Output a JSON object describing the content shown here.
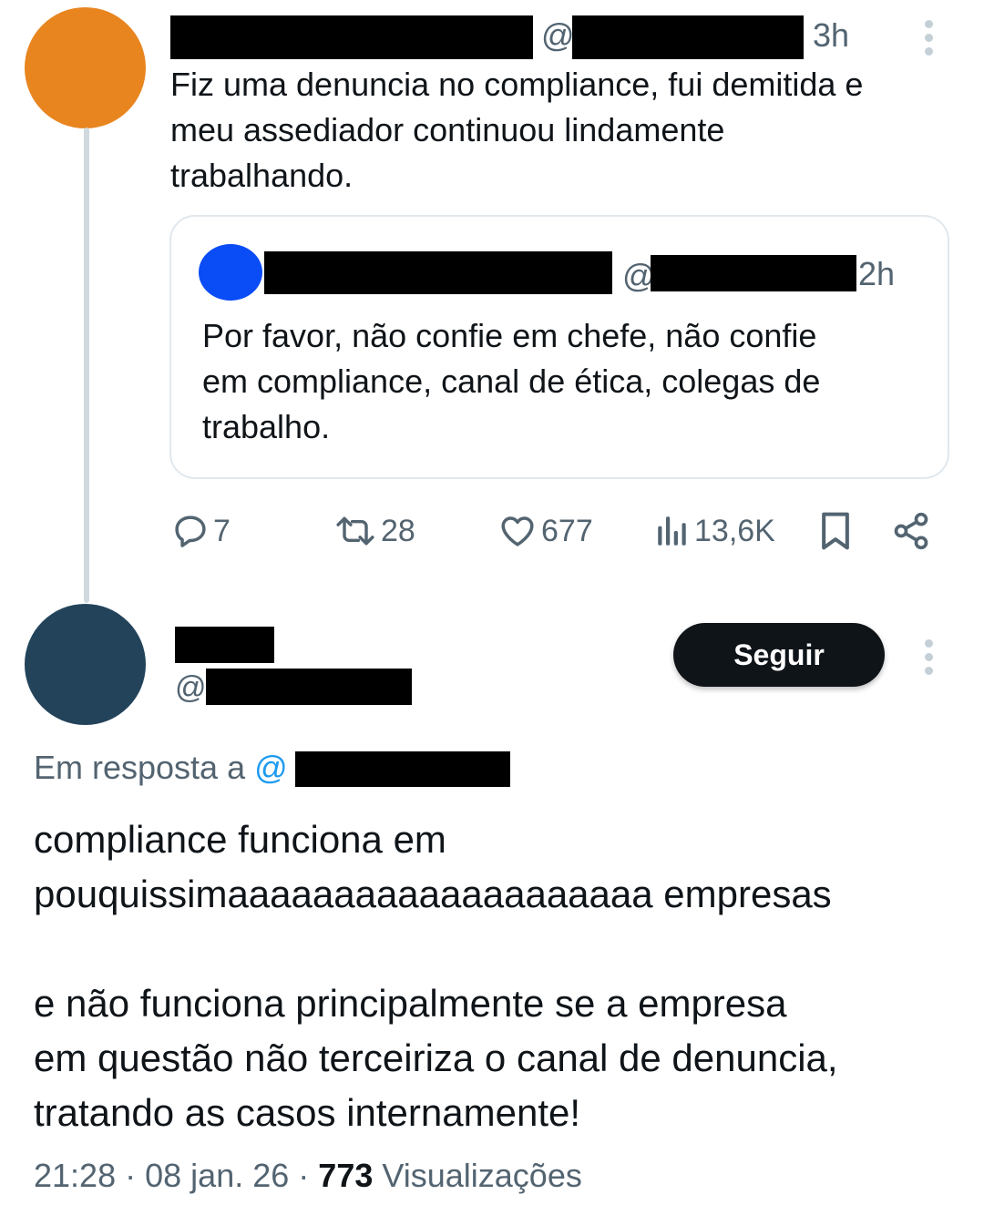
{
  "colors": {
    "avatar_author": "#e8851f",
    "avatar_quoted": "#0a4cf5",
    "avatar_replier": "#23435a",
    "text_primary": "#0f1419",
    "text_muted": "#536471",
    "link_blue": "#1d9bf0",
    "button_dark": "#0f1419"
  },
  "original_tweet": {
    "at_symbol": "@",
    "time": "3h",
    "text": "Fiz uma denuncia no compliance, fui demitida e\nmeu assediador continuou lindamente\ntrabalhando.",
    "quoted": {
      "at_symbol": "@",
      "time": "2h",
      "text": "Por favor, não confie em chefe, não confie\nem compliance, canal de ética, colegas de\ntrabalho."
    },
    "actions": {
      "replies": "7",
      "retweets": "28",
      "likes": "677",
      "views": "13,6K"
    }
  },
  "reply": {
    "at_symbol": "@",
    "follow_label": "Seguir",
    "replying_to_prefix": "Em resposta a ",
    "replying_to_at": "@",
    "text": "compliance funciona em\npouquissimaaaaaaaaaaaaaaaaaaaa empresas\n\ne não funciona principalmente se a empresa\nem questão não terceiriza o canal de denuncia,\ntratando as casos internamente!",
    "time": "21:28",
    "separator": "·",
    "date": "08 jan. 26",
    "views_count": "773",
    "views_label": "Visualizações"
  }
}
